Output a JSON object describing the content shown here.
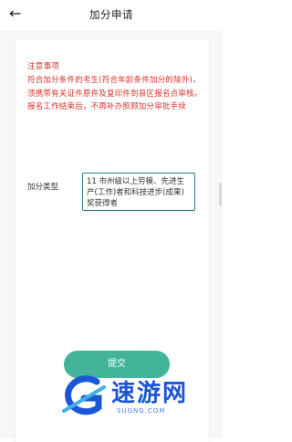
{
  "header": {
    "back_icon": "←",
    "title": "加分申请"
  },
  "notice": {
    "title": "注意事项",
    "body": "符合加分条件的考生(符合年龄条件加分的除外)，须携带有关证件原件及复印件到县区报名点审核。报名工作结束后，不再补办照顾加分审批手续"
  },
  "form": {
    "type_label": "加分类型",
    "type_value": "11 市州级以上劳模、先进生产(工作)者和科技进步(成果)奖获得者"
  },
  "submit_label": "提交",
  "watermark": {
    "text": "速游网",
    "url": "SUGNG.COM"
  },
  "colors": {
    "notice": "#d8322a",
    "accent": "#43b49a",
    "select_border": "#2b7d8c"
  }
}
